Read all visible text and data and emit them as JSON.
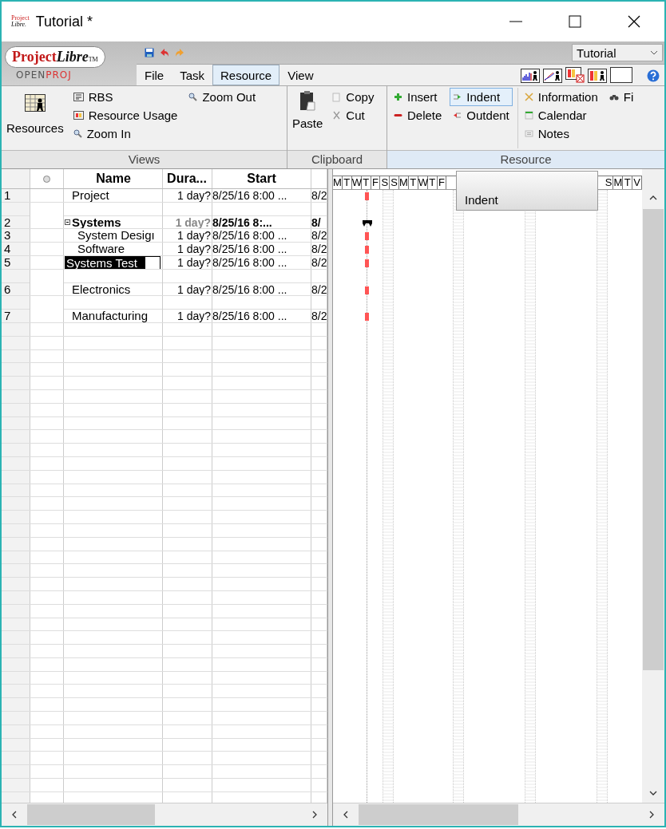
{
  "window": {
    "logo_line1": "Project",
    "logo_line2": "Libre.",
    "title": "Tutorial *"
  },
  "app_logo": {
    "name_plain": "Project",
    "name_italic": "Libre",
    "tm": "TM",
    "sub_plain": "OPEN",
    "sub_accent": "PROJ"
  },
  "menu_tabs": [
    {
      "label": "File",
      "selected": false
    },
    {
      "label": "Task",
      "selected": false
    },
    {
      "label": "Resource",
      "selected": true
    },
    {
      "label": "View",
      "selected": false
    }
  ],
  "project_select": {
    "value": "Tutorial"
  },
  "ribbon_groups": [
    {
      "title": "Views",
      "highlighted": false,
      "large": {
        "label": "Resources"
      },
      "items": [
        {
          "label": "RBS"
        },
        {
          "label": "Resource Usage"
        },
        {
          "label": "Zoom In"
        }
      ],
      "items2": [
        {
          "label": "Zoom Out"
        }
      ]
    },
    {
      "title": "Clipboard",
      "highlighted": false,
      "large": {
        "label": "Paste"
      },
      "items": [
        {
          "label": "Copy"
        },
        {
          "label": "Cut"
        }
      ]
    },
    {
      "title": "Resource",
      "highlighted": true,
      "items": [
        {
          "label": "Insert"
        },
        {
          "label": "Delete"
        }
      ],
      "items2": [
        {
          "label": "Indent",
          "selected": true
        },
        {
          "label": "Outdent",
          "selected": false
        }
      ],
      "items3": [
        {
          "label": "Information"
        },
        {
          "label": "Calendar"
        },
        {
          "label": "Notes"
        }
      ],
      "items4": [
        {
          "label": "Fi"
        }
      ]
    }
  ],
  "table": {
    "columns": [
      "Name",
      "Dura...",
      "Start"
    ],
    "rows": [
      {
        "id": "1",
        "name": "Project",
        "duration": "1 day?",
        "start": "8/25/16 8:00 ...",
        "finish": "8/2",
        "kind": "task",
        "summary": false,
        "indented": false,
        "selected": false,
        "gap_before": false
      },
      {
        "id": "2",
        "name": "Systems",
        "duration": "1 day?",
        "start": "8/25/16 8:...",
        "finish": "8/",
        "kind": "summary",
        "summary": true,
        "indented": false,
        "selected": false,
        "gap_before": true
      },
      {
        "id": "3",
        "name": "System Desigı",
        "duration": "1 day?",
        "start": "8/25/16 8:00 ...",
        "finish": "8/2",
        "kind": "task",
        "summary": false,
        "indented": true,
        "selected": false,
        "gap_before": false
      },
      {
        "id": "4",
        "name": "Software",
        "duration": "1 day?",
        "start": "8/25/16 8:00 ...",
        "finish": "8/2",
        "kind": "task",
        "summary": false,
        "indented": true,
        "selected": false,
        "gap_before": false
      },
      {
        "id": "5",
        "name": "Systems Test",
        "duration": "1 day?",
        "start": "8/25/16 8:00 ...",
        "finish": "8/2",
        "kind": "task",
        "summary": false,
        "indented": false,
        "selected": true,
        "gap_before": false
      },
      {
        "id": "6",
        "name": "Electronics",
        "duration": "1 day?",
        "start": "8/25/16 8:00 ...",
        "finish": "8/2",
        "kind": "task",
        "summary": false,
        "indented": false,
        "selected": false,
        "gap_before": true
      },
      {
        "id": "7",
        "name": "Manufacturing",
        "duration": "1 day?",
        "start": "8/25/16 8:00 ...",
        "finish": "8/2",
        "kind": "task",
        "summary": false,
        "indented": false,
        "selected": false,
        "gap_before": true
      }
    ]
  },
  "gantt": {
    "days_left": [
      "M",
      "T",
      "W",
      "T",
      "F",
      "S",
      "S",
      "M",
      "T",
      "W",
      "T",
      "F"
    ],
    "days_right": [
      "S",
      "M",
      "T",
      "V"
    ]
  },
  "tooltip": {
    "text": "Indent"
  }
}
